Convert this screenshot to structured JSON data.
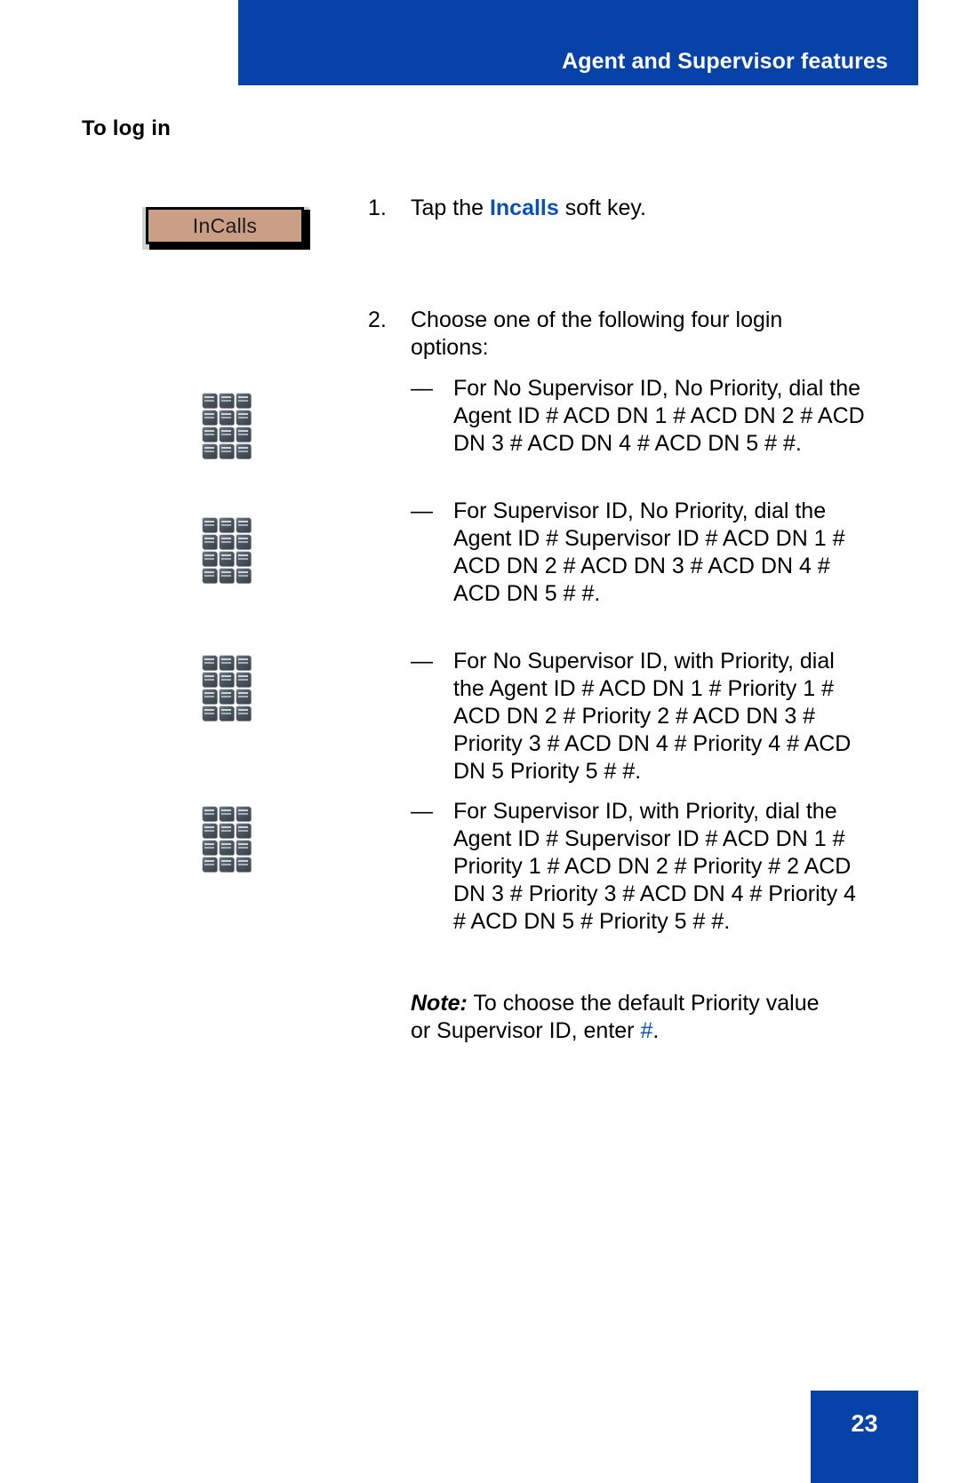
{
  "header": {
    "title": "Agent and Supervisor features"
  },
  "section": {
    "heading": "To log in"
  },
  "softkey": {
    "label": "InCalls"
  },
  "steps": [
    {
      "number": "1.",
      "text_before": "Tap the ",
      "highlight": "Incalls",
      "text_after": " soft key."
    },
    {
      "number": "2.",
      "text": "Choose one of the following four login options:"
    }
  ],
  "options": [
    {
      "marker": "—",
      "text": "For No Supervisor ID, No Priority, dial the Agent ID # ACD DN 1 # ACD DN 2 # ACD DN 3 # ACD DN 4 # ACD DN 5 # #."
    },
    {
      "marker": "—",
      "text": "For Supervisor ID, No Priority, dial the Agent ID # Supervisor ID # ACD DN 1 # ACD DN 2 # ACD DN 3 # ACD DN 4 # ACD DN 5 # #."
    },
    {
      "marker": "—",
      "text": "For No Supervisor ID, with Priority, dial the Agent ID # ACD DN 1 # Priority 1 # ACD DN 2 # Priority 2 # ACD DN 3 # Priority 3 # ACD DN 4 # Priority 4 # ACD DN 5 Priority 5 # #."
    },
    {
      "marker": "—",
      "text": "For Supervisor ID, with Priority, dial the Agent ID # Supervisor ID # ACD DN 1 # Priority 1 # ACD DN 2 # Priority # 2 ACD DN 3 # Priority 3 # ACD DN 4 # Priority 4 # ACD DN 5 # Priority 5 # #."
    }
  ],
  "note": {
    "lead": "Note:",
    "text_before": " To choose the default Priority value or Supervisor ID, enter ",
    "highlight": "#",
    "text_after": "."
  },
  "keypad": {
    "icon_name": "dial-keypad-icon",
    "keys": [
      "1",
      "2",
      "3",
      "4",
      "5",
      "6",
      "7",
      "8",
      "9",
      "*",
      "0",
      "#"
    ]
  },
  "footer": {
    "page_number": "23"
  },
  "colors": {
    "header_blue": "#0642a8",
    "link_blue": "#0b51b5",
    "softkey_fill": "#cb9e86",
    "softkey_backdrop": "#ccd6ce"
  }
}
